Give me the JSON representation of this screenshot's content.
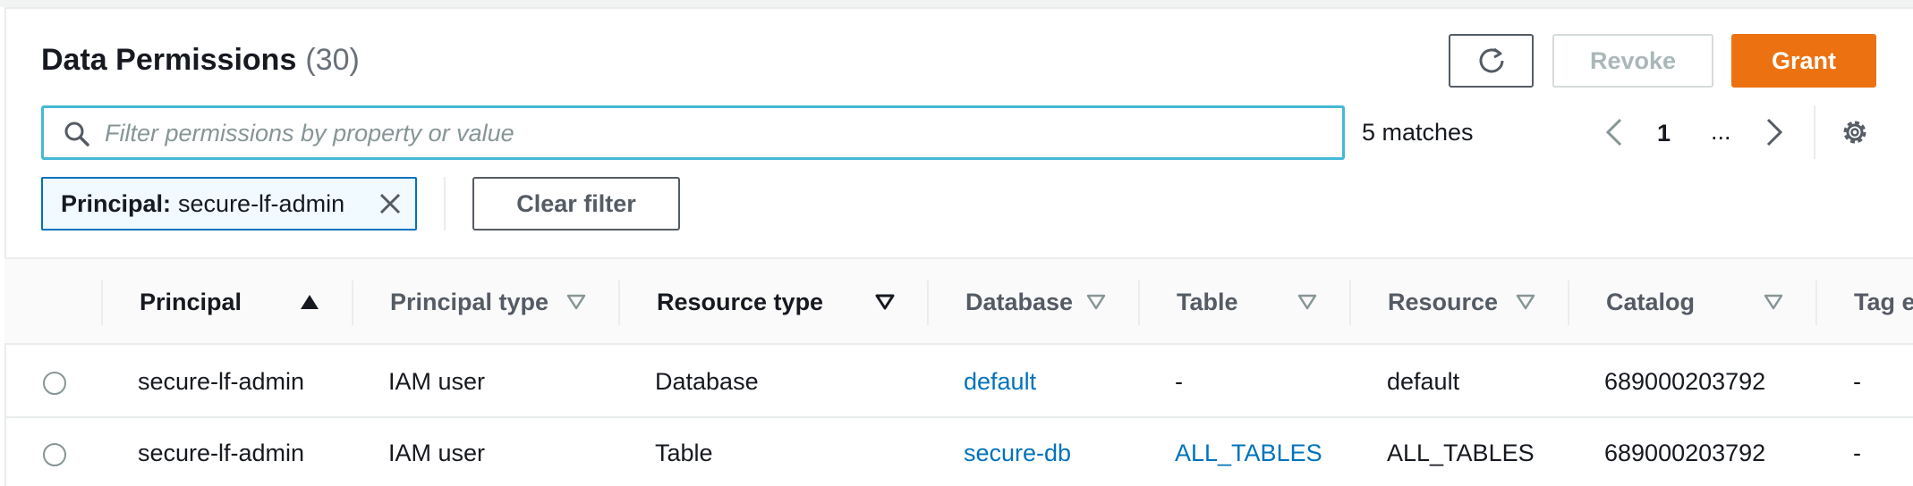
{
  "header": {
    "title": "Data Permissions",
    "count": "(30)",
    "revoke_label": "Revoke",
    "grant_label": "Grant"
  },
  "filter": {
    "placeholder": "Filter permissions by property or value",
    "value": "",
    "matches": "5 matches",
    "token_key": "Principal:",
    "token_value": "secure-lf-admin",
    "clear_label": "Clear filter"
  },
  "pagination": {
    "current_page": "1",
    "ellipsis": "..."
  },
  "colors": {
    "accent": "#ec7211",
    "link": "#0073bb",
    "focus": "#44b9d6"
  },
  "icons": [
    "refresh-icon",
    "search-icon",
    "chevron-left-icon",
    "chevron-right-icon",
    "gear-icon",
    "close-icon",
    "sort-ascending-icon",
    "sort-icon"
  ],
  "table": {
    "columns": [
      {
        "label": "Principal",
        "sort": "ascending"
      },
      {
        "label": "Principal type",
        "sort": "none"
      },
      {
        "label": "Resource type",
        "sort": "none-active"
      },
      {
        "label": "Database",
        "sort": "none"
      },
      {
        "label": "Table",
        "sort": "none"
      },
      {
        "label": "Resource",
        "sort": "none"
      },
      {
        "label": "Catalog",
        "sort": "none"
      },
      {
        "label": "Tag e",
        "sort": "none"
      }
    ],
    "rows": [
      {
        "principal": "secure-lf-admin",
        "principal_type": "IAM user",
        "resource_type": "Database",
        "database": "default",
        "table": "-",
        "resource": "default",
        "catalog": "689000203792",
        "tag": "-"
      },
      {
        "principal": "secure-lf-admin",
        "principal_type": "IAM user",
        "resource_type": "Table",
        "database": "secure-db",
        "table": "ALL_TABLES",
        "resource": "ALL_TABLES",
        "catalog": "689000203792",
        "tag": "-"
      }
    ]
  }
}
